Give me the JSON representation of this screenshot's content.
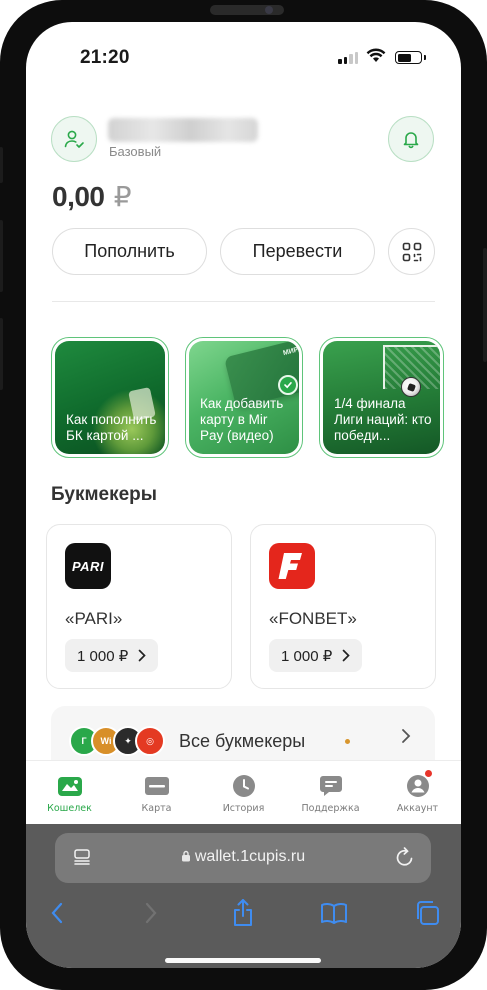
{
  "status_bar": {
    "time": "21:20"
  },
  "header": {
    "tier": "Базовый"
  },
  "balance": {
    "amount": "0,00",
    "currency": "₽"
  },
  "actions": {
    "topup": "Пополнить",
    "transfer": "Перевести"
  },
  "stories": [
    {
      "text": "Как пополнить БК картой ..."
    },
    {
      "text": "Как добавить карту в Mir Pay (видео)"
    },
    {
      "text": "1/4 финала Лиги наций: кто победи..."
    }
  ],
  "bookmakers": {
    "title": "Букмекеры",
    "items": [
      {
        "name": "«PARI»",
        "amount": "1 000 ₽",
        "logo_text": "PARI"
      },
      {
        "name": "«FONBET»",
        "amount": "1 000 ₽"
      }
    ],
    "all_label": "Все букмекеры"
  },
  "tabs": [
    {
      "label": "Кошелек",
      "icon": "wallet-icon"
    },
    {
      "label": "Карта",
      "icon": "card-icon"
    },
    {
      "label": "История",
      "icon": "clock-icon"
    },
    {
      "label": "Поддержка",
      "icon": "chat-icon"
    },
    {
      "label": "Аккаунт",
      "icon": "user-icon"
    }
  ],
  "browser": {
    "url": "wallet.1cupis.ru"
  },
  "colors": {
    "accent": "#2aa84a",
    "fonbet": "#e4261c",
    "safari_bar": "#5b5b5b"
  }
}
